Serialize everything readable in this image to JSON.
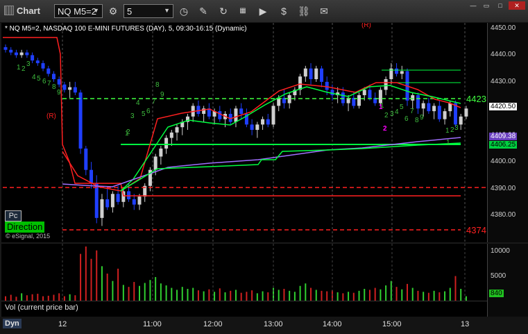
{
  "toolbar": {
    "title": "Chart",
    "symbol": "NQ M5=2",
    "interval": "5",
    "tools": [
      {
        "icon": "gear-icon"
      },
      {
        "icon": "clock-icon"
      },
      {
        "icon": "pencil-icon"
      },
      {
        "icon": "refresh-icon"
      },
      {
        "icon": "grid-icon"
      },
      {
        "icon": "play-icon"
      },
      {
        "icon": "dollar-icon"
      },
      {
        "icon": "link-icon"
      },
      {
        "icon": "chat-icon"
      }
    ]
  },
  "chart": {
    "header": "* NQ M5=2, NASDAQ 100 E-MINI FUTURES (DAY), 5, 09:30-16:15 (Dynamic)",
    "y_ticks": [
      "4450.00",
      "4440.00",
      "4430.00",
      "4420.00",
      "4410.00",
      "4400.00",
      "4390.00",
      "4380.00"
    ],
    "price_labels": {
      "last": "4420.50",
      "purple": "4409.38",
      "green": "4406.25"
    },
    "level_labels": {
      "upper": "4423",
      "lower": "4374"
    },
    "markers": {
      "r_top": "(R)",
      "r_left": "(R)",
      "one": "1",
      "two": "2"
    },
    "pc_label": "Pc",
    "direction_label": "Direction",
    "copyright": "© eSignal, 2015",
    "colors": {
      "up": "#cfcfcf",
      "down": "#1f3fff",
      "red": "#ff2020",
      "green": "#00ff40",
      "dashgreen": "#40ff40",
      "purple": "#a070ff",
      "magenta": "#ff00ff"
    }
  },
  "volume": {
    "y_ticks": [
      "10000",
      "5000"
    ],
    "last": "840",
    "label": "Vol (current price bar)"
  },
  "xaxis": {
    "dyn": "Dyn",
    "labels": [
      "12",
      "11:00",
      "12:00",
      "13:00",
      "14:00",
      "15:00",
      "13"
    ]
  },
  "chart_data": {
    "type": "candlestick",
    "x": [
      "12",
      "11:00",
      "12:00",
      "13:00",
      "14:00",
      "15:00",
      "13"
    ],
    "ylim": [
      4372,
      4452
    ],
    "y_ticks": [
      4450,
      4440,
      4430,
      4420,
      4410,
      4400,
      4390,
      4380
    ],
    "levels": {
      "upper": 4423,
      "lower": 4374,
      "last": 4420.5,
      "purple": 4409.38,
      "green": 4406.25
    }
  }
}
